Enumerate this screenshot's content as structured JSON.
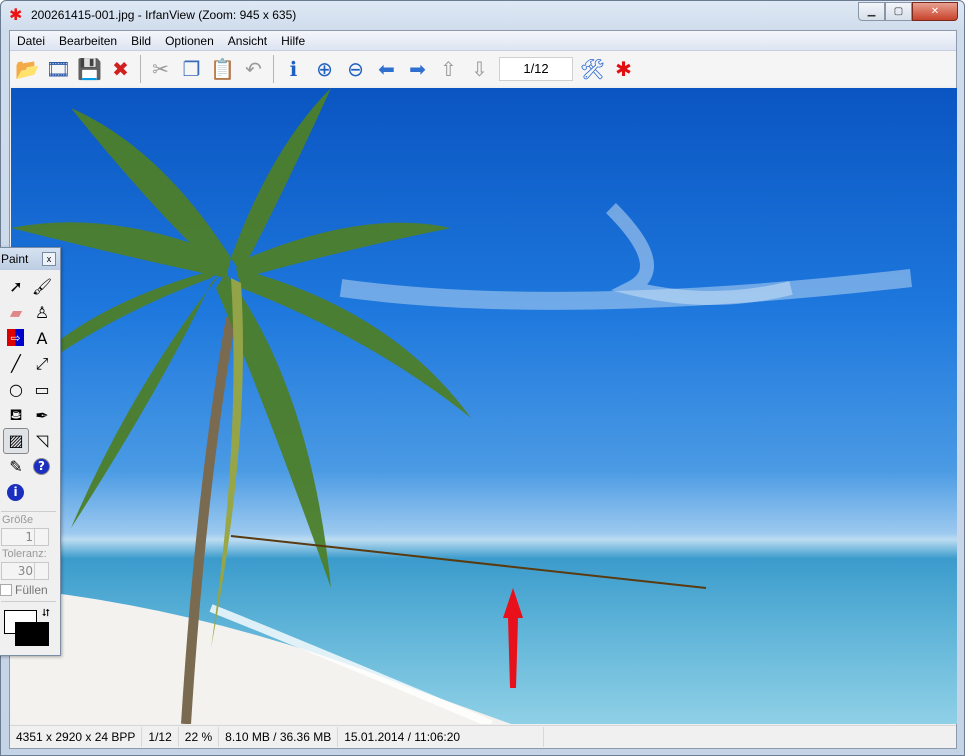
{
  "window": {
    "title": "200261415-001.jpg - IrfanView (Zoom: 945 x 635)",
    "minimize": "▁",
    "maximize": "▢",
    "close": "✕"
  },
  "menu": [
    "Datei",
    "Bearbeiten",
    "Bild",
    "Optionen",
    "Ansicht",
    "Hilfe"
  ],
  "toolbar": {
    "icons": [
      {
        "name": "open-folder-icon",
        "glyph": "📂",
        "color": "#e0a020"
      },
      {
        "name": "slideshow-icon",
        "glyph": "🎞",
        "color": "#2a5aa8"
      },
      {
        "name": "save-icon",
        "glyph": "💾",
        "color": "#2a4aa8"
      },
      {
        "name": "delete-icon",
        "glyph": "✖",
        "color": "#d02020"
      },
      {
        "name": "cut-icon",
        "glyph": "✂",
        "color": "#999999"
      },
      {
        "name": "copy-icon",
        "glyph": "❐",
        "color": "#3a6ab8"
      },
      {
        "name": "paste-icon",
        "glyph": "📋",
        "color": "#d0a020"
      },
      {
        "name": "undo-icon",
        "glyph": "↶",
        "color": "#999999"
      },
      {
        "name": "info-icon",
        "glyph": "ℹ",
        "color": "#1f5fc0"
      },
      {
        "name": "zoom-in-icon",
        "glyph": "⊕",
        "color": "#1f5fc0"
      },
      {
        "name": "zoom-out-icon",
        "glyph": "⊖",
        "color": "#1f5fc0"
      },
      {
        "name": "previous-icon",
        "glyph": "⬅",
        "color": "#2f6fd0"
      },
      {
        "name": "next-icon",
        "glyph": "➡",
        "color": "#2f6fd0"
      },
      {
        "name": "first-page-icon",
        "glyph": "⇧",
        "color": "#999999"
      },
      {
        "name": "last-page-icon",
        "glyph": "⇩",
        "color": "#999999"
      }
    ],
    "page": "1/12",
    "settings_icon": {
      "glyph": "🛠",
      "color": "#2a6ad0"
    },
    "irfan_icon": {
      "glyph": "✱",
      "color": "#e01010"
    }
  },
  "paint": {
    "title": "Paint",
    "close": "x",
    "tools": [
      {
        "name": "selection-arrow-icon",
        "glyph": "➚"
      },
      {
        "name": "brush-icon",
        "glyph": "🖌"
      },
      {
        "name": "eraser-icon",
        "glyph": "▰"
      },
      {
        "name": "clone-stamp-icon",
        "glyph": "♙"
      },
      {
        "name": "arrow-shape-icon",
        "glyph": "⇨"
      },
      {
        "name": "text-icon",
        "glyph": "A"
      },
      {
        "name": "line-icon",
        "glyph": "╱"
      },
      {
        "name": "double-arrow-icon",
        "glyph": "⤢"
      },
      {
        "name": "circle-icon",
        "glyph": "○"
      },
      {
        "name": "rectangle-icon",
        "glyph": "▭"
      },
      {
        "name": "fill-bucket-icon",
        "glyph": "⛾"
      },
      {
        "name": "color-picker-icon",
        "glyph": "✒"
      },
      {
        "name": "image-effects-icon",
        "glyph": "▨"
      },
      {
        "name": "measure-icon",
        "glyph": "◹"
      },
      {
        "name": "red-eye-icon",
        "glyph": "✎"
      },
      {
        "name": "help-icon",
        "glyph": "?"
      },
      {
        "name": "info-icon",
        "glyph": "i"
      }
    ],
    "size_label": "Größe",
    "size_value": "1",
    "tolerance_label": "Toleranz:",
    "tolerance_value": "30",
    "fill_label": "Füllen",
    "swap": "⮃"
  },
  "status": [
    "4351 x 2920 x 24 BPP",
    "1/12",
    "22 %",
    "8.10 MB / 36.36 MB",
    "15.01.2014 / 11:06:20"
  ]
}
